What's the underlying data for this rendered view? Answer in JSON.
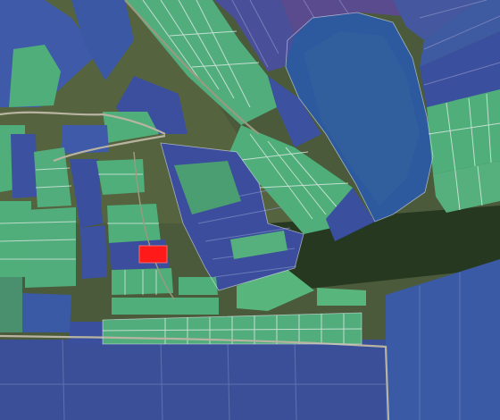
{
  "map": {
    "type": "satellite imagery with cadastral parcel overlay",
    "colors": {
      "terrain": "#4a5a3a",
      "terrain_dark": "#2e3b24",
      "road": "#b9b4a2",
      "parcel_blue": "#3a4f9e",
      "parcel_green": "#4fae7a",
      "parcel_purple": "#5a4a8e",
      "forest": "#2d5a9e",
      "selected_parcel": "#ff1a1a",
      "parcel_border": "#e8ecf4"
    },
    "legend": [],
    "selected_parcel": {
      "color": "#ff1a1a"
    }
  }
}
